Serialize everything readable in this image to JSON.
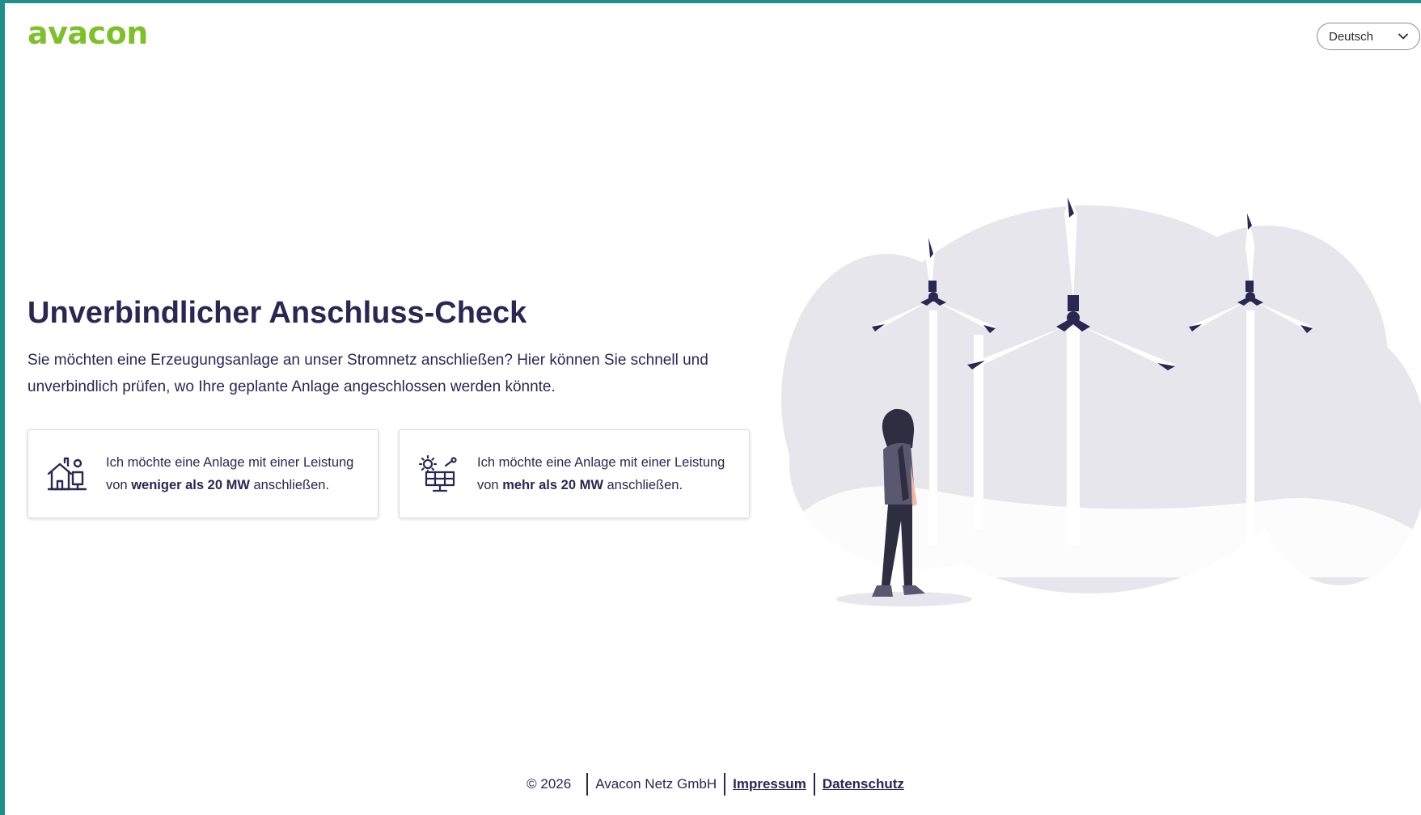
{
  "brand": {
    "logo_text": "avacon",
    "logo_color": "#7fbf2a",
    "accent_color": "#2b2753",
    "frame_color": "#1f8f8a"
  },
  "header": {
    "language": {
      "selected": "Deutsch",
      "icon": "chevron-down-icon"
    }
  },
  "main": {
    "title": "Unverbindlicher Anschluss-Check",
    "intro": "Sie möchten eine Erzeugungsanlage an unser Stromnetz anschließen? Hier können Sie schnell und unverbindlich prüfen, wo Ihre geplante Anlage angeschlossen werden könnte.",
    "options": [
      {
        "icon": "house-solar-icon",
        "text_before": "Ich möchte eine Anlage mit einer Leistung von ",
        "text_bold": "weniger als 20 MW",
        "text_after": " anschließen."
      },
      {
        "icon": "solar-plant-icon",
        "text_before": "Ich möchte eine Anlage mit einer Leistung von ",
        "text_bold": "mehr als 20 MW",
        "text_after": " anschließen."
      }
    ]
  },
  "illustration": {
    "subject": "wind-turbines-woman-illustration"
  },
  "footer": {
    "copyright": "© 2026",
    "company": "Avacon Netz GmbH",
    "impressum": "Impressum",
    "datenschutz": "Datenschutz"
  }
}
